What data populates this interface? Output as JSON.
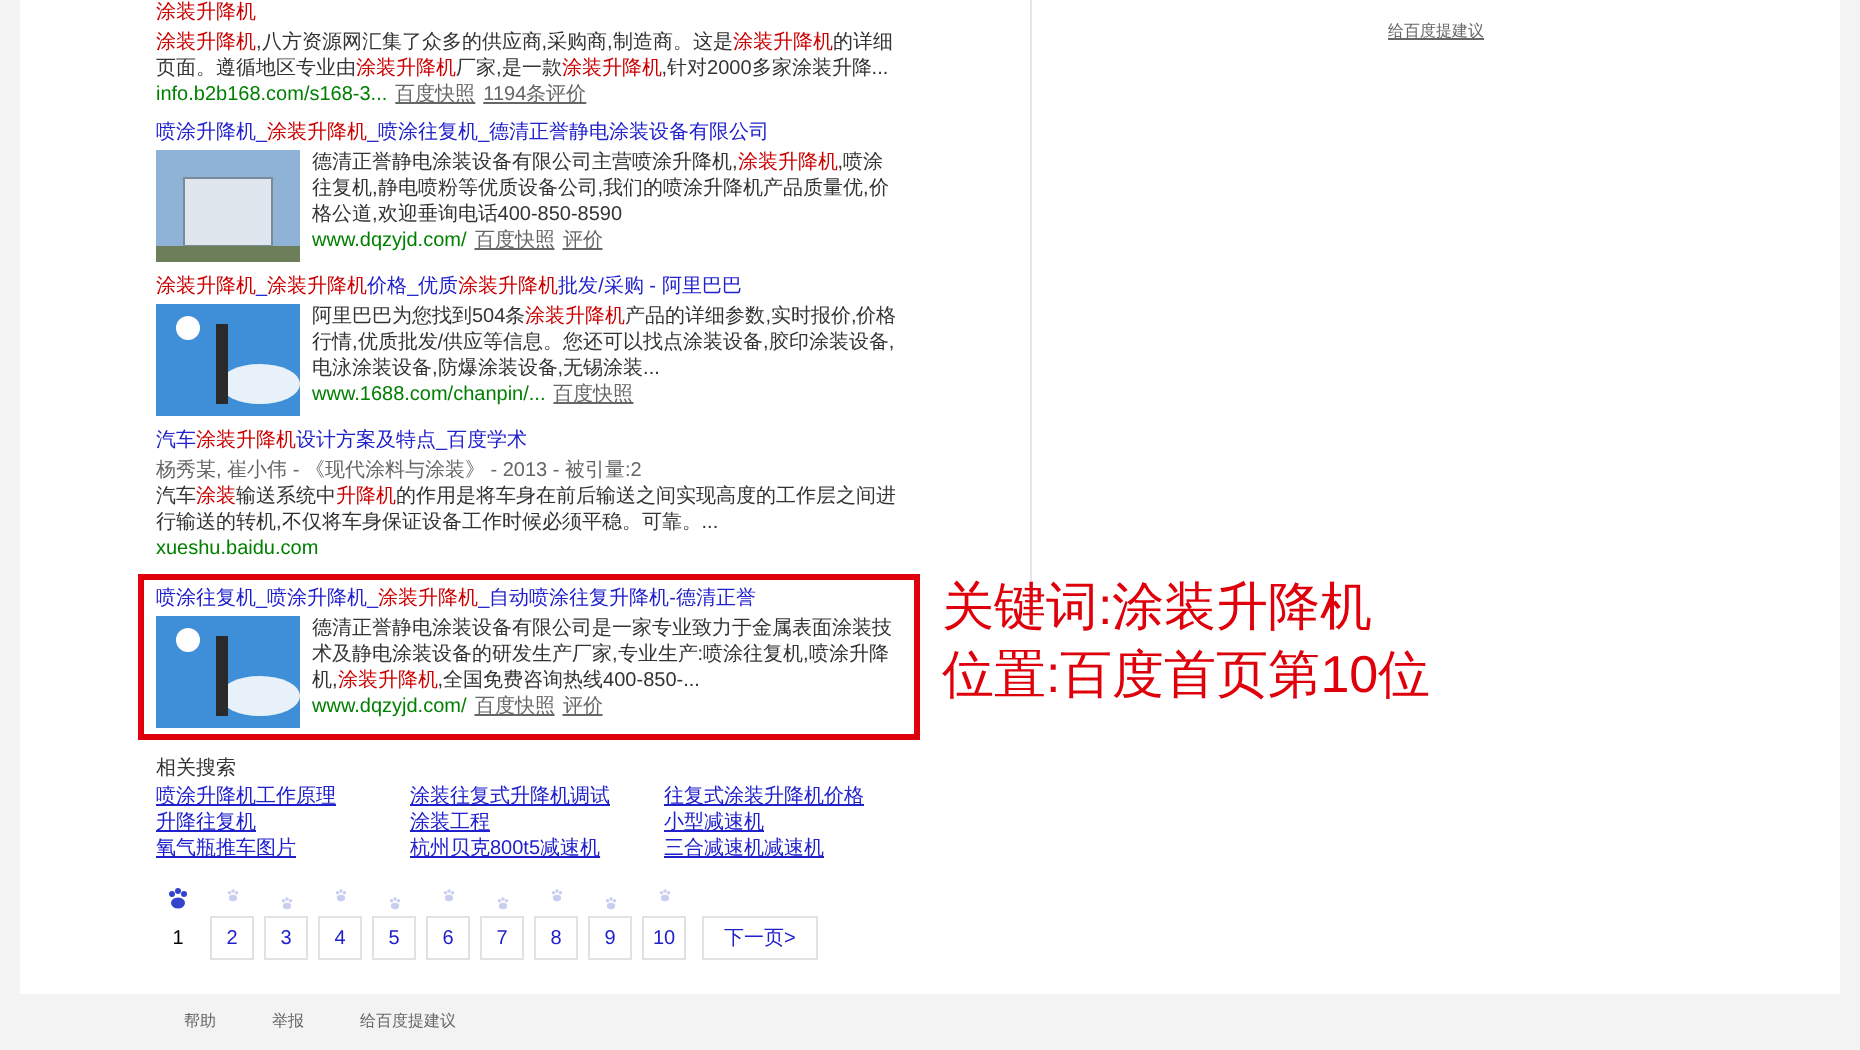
{
  "results": [
    {
      "title": [
        {
          "text": "涂装升降机",
          "em": true
        }
      ],
      "snippet": [
        {
          "text": "涂装升降机",
          "em": true
        },
        {
          "text": ",八方资源网汇集了众多的供应商,采购商,制造商。这是",
          "em": false
        },
        {
          "text": "涂装升降机",
          "em": true
        },
        {
          "text": "的详细页面。遵循地区专业由",
          "em": false
        },
        {
          "text": "涂装升降机",
          "em": true
        },
        {
          "text": "厂家,是一款",
          "em": false
        },
        {
          "text": "涂装升降机",
          "em": true
        },
        {
          "text": ",针对2000多家涂装升降...",
          "em": false
        }
      ],
      "url": "info.b2b168.com/s168-3...",
      "links": [
        "百度快照",
        "1194条评价"
      ],
      "kind": "text",
      "boxed": false
    },
    {
      "title": [
        {
          "text": "喷涂升降机_",
          "em": false
        },
        {
          "text": "涂装升降机",
          "em": true
        },
        {
          "text": "_喷涂往复机_德清正誉静电涂装设备有限公司",
          "em": false
        }
      ],
      "snippet": [
        {
          "text": "德清正誉静电涂装设备有限公司主营喷涂升降机,",
          "em": false
        },
        {
          "text": "涂装升降机",
          "em": true
        },
        {
          "text": ",喷涂往复机,静电喷粉等优质设备公司,我们的喷涂升降机产品质量优,价格公道,欢迎垂询电话400-850-8590",
          "em": false
        }
      ],
      "url": "www.dqzyjd.com/",
      "links": [
        "百度快照",
        "评价"
      ],
      "kind": "image",
      "boxed": false
    },
    {
      "title": [
        {
          "text": "涂装升降机",
          "em": true
        },
        {
          "text": "_",
          "em": false
        },
        {
          "text": "涂装升降机",
          "em": true
        },
        {
          "text": "价格_优质",
          "em": false
        },
        {
          "text": "涂装升降机",
          "em": true
        },
        {
          "text": "批发/采购 - 阿里巴巴",
          "em": false
        }
      ],
      "snippet": [
        {
          "text": "阿里巴巴为您找到504条",
          "em": false
        },
        {
          "text": "涂装升降机",
          "em": true
        },
        {
          "text": "产品的详细参数,实时报价,价格行情,优质批发/供应等信息。您还可以找点涂装设备,胶印涂装设备,电泳涂装设备,防爆涂装设备,无锡涂装...",
          "em": false
        }
      ],
      "url": "www.1688.com/chanpin/...",
      "links": [
        "百度快照"
      ],
      "kind": "image",
      "boxed": false
    },
    {
      "title": [
        {
          "text": "汽车",
          "em": false
        },
        {
          "text": "涂装升降机",
          "em": true
        },
        {
          "text": "设计方案及特点_百度学术",
          "em": false
        }
      ],
      "byline": "杨秀某, 崔小伟 - 《现代涂料与涂装》 - 2013 - 被引量:2",
      "snippet": [
        {
          "text": "汽车",
          "em": false
        },
        {
          "text": "涂装",
          "em": true
        },
        {
          "text": "输送系统中",
          "em": false
        },
        {
          "text": "升降机",
          "em": true
        },
        {
          "text": "的作用是将车身在前后输送之间实现高度的工作层之间进行输送的转机,不仅将车身保证设备工作时候必须平稳。可靠。...",
          "em": false
        }
      ],
      "url": "xueshu.baidu.com",
      "kind": "text",
      "boxed": false
    },
    {
      "title": [
        {
          "text": "喷涂往复机_喷涂升降机_",
          "em": false
        },
        {
          "text": "涂装升降机",
          "em": true
        },
        {
          "text": "_自动喷涂往复升降机-德清正誉",
          "em": false
        }
      ],
      "snippet": [
        {
          "text": "德清正誉静电涂装设备有限公司是一家专业致力于金属表面涂装技术及静电涂装设备的研发生产厂家,专业生产:喷涂往复机,喷涂升降机,",
          "em": false
        },
        {
          "text": "涂装升降机",
          "em": true
        },
        {
          "text": ",全国免费咨询热线400-850-...",
          "em": false
        }
      ],
      "url": "www.dqzyjd.com/",
      "links": [
        "百度快照",
        "评价"
      ],
      "kind": "image",
      "boxed": true
    }
  ],
  "annotation": [
    "关键词:涂装升降机",
    "位置:百度首页第10位"
  ],
  "related": {
    "title": "相关搜索",
    "items": [
      "喷涂升降机工作原理",
      "涂装往复式升降机调试",
      "往复式涂装升降机价格",
      "升降往复机",
      "涂装工程",
      "小型减速机",
      "氧气瓶推车图片",
      "杭州贝克800t5减速机",
      "三合减速机减速机"
    ]
  },
  "pages": [
    {
      "label": "1",
      "selected": true
    },
    {
      "label": "2",
      "selected": false
    },
    {
      "label": "3",
      "selected": false
    },
    {
      "label": "4",
      "selected": false
    },
    {
      "label": "5",
      "selected": false
    },
    {
      "label": "6",
      "selected": false
    },
    {
      "label": "7",
      "selected": false
    },
    {
      "label": "8",
      "selected": false
    },
    {
      "label": "9",
      "selected": false
    },
    {
      "label": "10",
      "selected": false
    }
  ],
  "next_page": "下一页>",
  "side_link": "给百度提建议",
  "footer": [
    "帮助",
    "举报",
    "给百度提建议"
  ]
}
